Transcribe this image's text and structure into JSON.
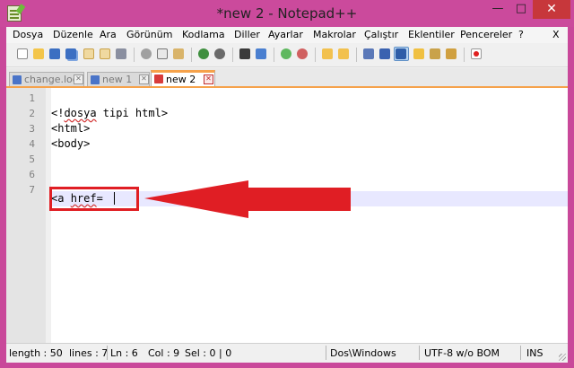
{
  "window": {
    "title": "*new  2 - Notepad++",
    "minimize_label": "—",
    "maximize_label": "□",
    "close_label": "✕"
  },
  "menu": [
    "Dosya",
    "Düzenle",
    "Ara",
    "Görünüm",
    "Kodlama",
    "Diller",
    "Ayarlar",
    "Makrolar",
    "Çalıştır",
    "Eklentiler",
    "Pencereler",
    "?",
    "X"
  ],
  "toolbar_icons": [
    "new-file-icon",
    "open-file-icon",
    "save-icon",
    "save-all-icon",
    "close-icon",
    "close-all-icon",
    "print-icon",
    "cut-icon",
    "copy-icon",
    "paste-icon",
    "undo-icon",
    "redo-icon",
    "find-icon",
    "replace-icon",
    "zoom-in-icon",
    "zoom-out-icon",
    "sync-vertical-icon",
    "sync-horizontal-icon",
    "word-wrap-icon",
    "show-all-characters-icon",
    "indent-guide-icon",
    "user-language-icon",
    "document-map-icon",
    "function-list-icon",
    "record-macro-icon"
  ],
  "tabs": [
    {
      "label": "change.log",
      "active": false
    },
    {
      "label": "new  1",
      "active": false
    },
    {
      "label": "new  2",
      "active": true
    }
  ],
  "editor": {
    "line_numbers": [
      "1",
      "2",
      "3",
      "4",
      "5",
      "6",
      "7"
    ],
    "lines": [
      {
        "pre": "",
        "squig": "",
        "post": ""
      },
      {
        "pre": "<!",
        "squig": "dosya",
        "post": " tipi html>"
      },
      {
        "pre": "<html>",
        "squig": "",
        "post": ""
      },
      {
        "pre": "<body>",
        "squig": "",
        "post": ""
      },
      {
        "pre": "",
        "squig": "",
        "post": ""
      },
      {
        "pre": "<a ",
        "squig": "href",
        "post": "="
      },
      {
        "pre": "",
        "squig": "",
        "post": ""
      }
    ]
  },
  "status": {
    "length": "length : 50",
    "lines": "lines : 7",
    "ln": "Ln : 6",
    "col": "Col : 9",
    "sel": "Sel : 0 | 0",
    "eol": "Dos\\Windows",
    "encoding": "UTF-8 w/o BOM",
    "mode": "INS"
  },
  "colors": {
    "highlight": "#e01e24",
    "window_frame": "#cb4a9c",
    "active_tab_accent": "#f6a24b",
    "current_line": "#e8e8ff"
  }
}
